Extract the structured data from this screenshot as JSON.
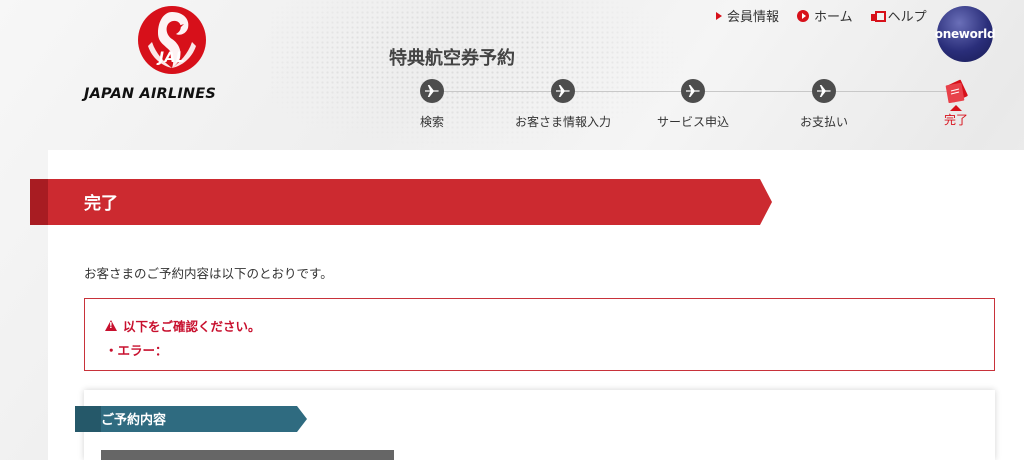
{
  "brand": {
    "logo_mark": "JAL",
    "name": "JAPAN AIRLINES",
    "accent_color": "#d7101a"
  },
  "header": {
    "links": [
      {
        "label": "会員情報",
        "icon": "triangle-arrow-icon"
      },
      {
        "label": "ホーム",
        "icon": "circle-play-icon"
      },
      {
        "label": "ヘルプ",
        "icon": "help-icon"
      }
    ],
    "alliance_logo": "oneworld",
    "page_title": "特典航空券予約"
  },
  "steps": [
    {
      "label": "検索",
      "icon": "airplane-icon",
      "state": "done"
    },
    {
      "label": "お客さま情報入力",
      "icon": "airplane-icon",
      "state": "done"
    },
    {
      "label": "サービス申込",
      "icon": "airplane-icon",
      "state": "done"
    },
    {
      "label": "お支払い",
      "icon": "airplane-icon",
      "state": "done"
    },
    {
      "label": "完了",
      "icon": "ticket-icon",
      "state": "current"
    }
  ],
  "main": {
    "banner_title": "完了",
    "intro": "お客さまのご予約内容は以下のとおりです。",
    "alert": {
      "title": "以下をご確認ください。",
      "line": "・エラー："
    },
    "section_title": "ご予約内容"
  },
  "colors": {
    "banner_red": "#cc2a30",
    "section_teal": "#2f6b80",
    "step_dark": "#4d4d4d"
  }
}
